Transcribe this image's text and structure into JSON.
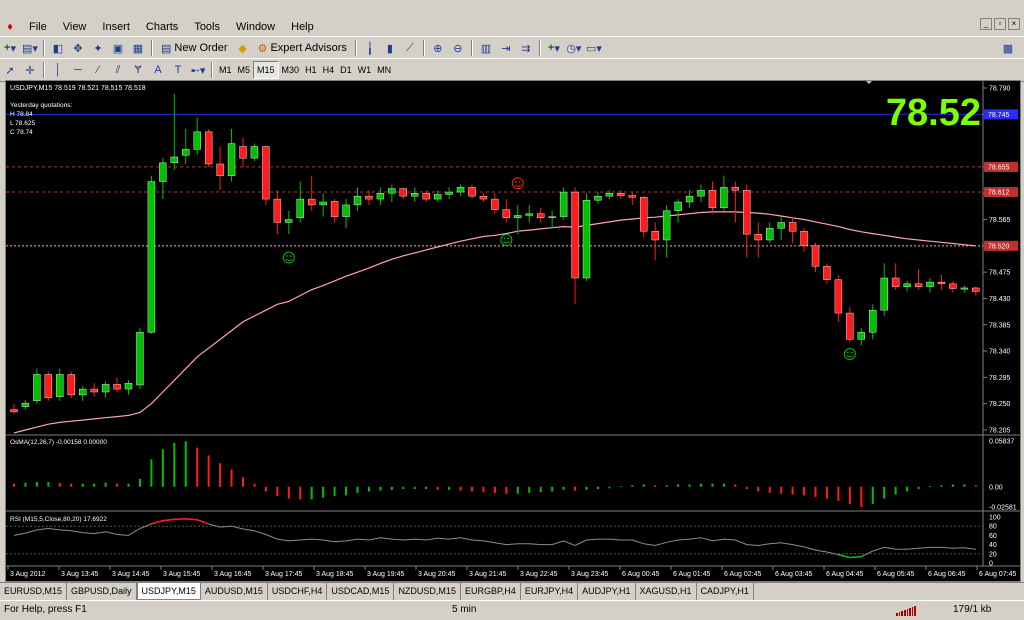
{
  "menu": [
    "File",
    "View",
    "Insert",
    "Charts",
    "Tools",
    "Window",
    "Help"
  ],
  "toolbar": {
    "new_order": "New Order",
    "expert_advisors": "Expert Advisors"
  },
  "timeframes": [
    "M1",
    "M5",
    "M15",
    "M30",
    "H1",
    "H4",
    "D1",
    "W1",
    "MN"
  ],
  "active_timeframe": "M15",
  "chart": {
    "header": "USDJPY,M15  78.519 78.521 78.515 78.518",
    "yesterday_title": "Yesterday quotations:",
    "y_high": "H 78.84",
    "y_low": "L 78.625",
    "y_close": "C 78.74",
    "big_price": "78.52",
    "price_ticks": [
      "78.790",
      "78.745",
      "78.655",
      "78.610",
      "78.565",
      "78.520",
      "78.475",
      "78.430",
      "78.385",
      "78.340",
      "78.295",
      "78.250",
      "78.205"
    ],
    "osma_label": "OsMA(12,26,7) -0.00158 0.00000",
    "osma_ticks": [
      "0.05837",
      "0.00",
      "-0.02581"
    ],
    "rsi_label": "RSI (M15,5,Close,80,20) 17.6922",
    "rsi_ticks": [
      "100",
      "80",
      "60",
      "40",
      "20",
      "0"
    ],
    "time_labels": [
      "3 Aug 2012",
      "3 Aug 13:45",
      "3 Aug 14:45",
      "3 Aug 15:45",
      "3 Aug 16:45",
      "3 Aug 17:45",
      "3 Aug 18:45",
      "3 Aug 19:45",
      "3 Aug 20:45",
      "3 Aug 21:45",
      "3 Aug 22:45",
      "3 Aug 23:45",
      "6 Aug 00:45",
      "6 Aug 01:45",
      "6 Aug 02:45",
      "6 Aug 03:45",
      "6 Aug 04:45",
      "6 Aug 05:45",
      "6 Aug 06:45",
      "6 Aug 07:45"
    ],
    "candles": [
      [
        78.24,
        78.25,
        78.232,
        78.236
      ],
      [
        78.245,
        78.256,
        78.24,
        78.251
      ],
      [
        78.255,
        78.31,
        78.25,
        78.3
      ],
      [
        78.3,
        78.305,
        78.255,
        78.26
      ],
      [
        78.262,
        78.31,
        78.255,
        78.3
      ],
      [
        78.3,
        78.305,
        78.26,
        78.265
      ],
      [
        78.265,
        78.28,
        78.255,
        78.275
      ],
      [
        78.275,
        78.285,
        78.262,
        78.27
      ],
      [
        78.27,
        78.288,
        78.26,
        78.283
      ],
      [
        78.283,
        78.295,
        78.27,
        78.275
      ],
      [
        78.275,
        78.29,
        78.265,
        78.285
      ],
      [
        78.282,
        78.38,
        78.275,
        78.372
      ],
      [
        78.372,
        78.64,
        78.37,
        78.63
      ],
      [
        78.63,
        78.67,
        78.6,
        78.662
      ],
      [
        78.662,
        78.78,
        78.65,
        78.672
      ],
      [
        78.675,
        78.72,
        78.66,
        78.685
      ],
      [
        78.685,
        78.74,
        78.675,
        78.715
      ],
      [
        78.715,
        78.72,
        78.655,
        78.66
      ],
      [
        78.66,
        78.69,
        78.615,
        78.64
      ],
      [
        78.64,
        78.72,
        78.63,
        78.695
      ],
      [
        78.69,
        78.705,
        78.655,
        78.67
      ],
      [
        78.67,
        78.695,
        78.665,
        78.69
      ],
      [
        78.69,
        78.69,
        78.59,
        78.6
      ],
      [
        78.6,
        78.615,
        78.54,
        78.56
      ],
      [
        78.56,
        78.58,
        78.54,
        78.565
      ],
      [
        78.568,
        78.63,
        78.56,
        78.6
      ],
      [
        78.6,
        78.64,
        78.58,
        78.59
      ],
      [
        78.59,
        78.61,
        78.57,
        78.595
      ],
      [
        78.596,
        78.6,
        78.56,
        78.57
      ],
      [
        78.57,
        78.6,
        78.55,
        78.59
      ],
      [
        78.59,
        78.62,
        78.58,
        78.605
      ],
      [
        78.605,
        78.615,
        78.59,
        78.6
      ],
      [
        78.6,
        78.62,
        78.59,
        78.61
      ],
      [
        78.61,
        78.625,
        78.595,
        78.618
      ],
      [
        78.618,
        78.62,
        78.6,
        78.605
      ],
      [
        78.605,
        78.62,
        78.595,
        78.61
      ],
      [
        78.61,
        78.615,
        78.595,
        78.6
      ],
      [
        78.6,
        78.615,
        78.595,
        78.608
      ],
      [
        78.608,
        78.62,
        78.6,
        78.612
      ],
      [
        78.612,
        78.625,
        78.605,
        78.62
      ],
      [
        78.62,
        78.625,
        78.6,
        78.605
      ],
      [
        78.605,
        78.61,
        78.595,
        78.6
      ],
      [
        78.6,
        78.61,
        78.575,
        78.582
      ],
      [
        78.582,
        78.6,
        78.56,
        78.568
      ],
      [
        78.568,
        78.59,
        78.54,
        78.572
      ],
      [
        78.572,
        78.59,
        78.56,
        78.575
      ],
      [
        78.575,
        78.585,
        78.56,
        78.568
      ],
      [
        78.568,
        78.58,
        78.55,
        78.57
      ],
      [
        78.57,
        78.62,
        78.565,
        78.612
      ],
      [
        78.612,
        78.62,
        78.42,
        78.465
      ],
      [
        78.465,
        78.61,
        78.46,
        78.598
      ],
      [
        78.598,
        78.612,
        78.592,
        78.605
      ],
      [
        78.605,
        78.615,
        78.6,
        78.61
      ],
      [
        78.61,
        78.615,
        78.6,
        78.606
      ],
      [
        78.606,
        78.612,
        78.59,
        78.603
      ],
      [
        78.603,
        78.605,
        78.535,
        78.545
      ],
      [
        78.545,
        78.56,
        78.495,
        78.53
      ],
      [
        78.53,
        78.59,
        78.5,
        78.58
      ],
      [
        78.58,
        78.6,
        78.56,
        78.595
      ],
      [
        78.595,
        78.615,
        78.585,
        78.605
      ],
      [
        78.605,
        78.625,
        78.595,
        78.615
      ],
      [
        78.615,
        78.63,
        78.575,
        78.585
      ],
      [
        78.585,
        78.64,
        78.58,
        78.62
      ],
      [
        78.62,
        78.63,
        78.56,
        78.615
      ],
      [
        78.615,
        78.625,
        78.5,
        78.54
      ],
      [
        78.54,
        78.56,
        78.5,
        78.53
      ],
      [
        78.53,
        78.56,
        78.525,
        78.55
      ],
      [
        78.55,
        78.57,
        78.53,
        78.56
      ],
      [
        78.56,
        78.57,
        78.525,
        78.545
      ],
      [
        78.545,
        78.55,
        78.51,
        78.52
      ],
      [
        78.52,
        78.525,
        78.475,
        78.485
      ],
      [
        78.485,
        78.49,
        78.455,
        78.462
      ],
      [
        78.462,
        78.47,
        78.39,
        78.405
      ],
      [
        78.405,
        78.415,
        78.355,
        78.36
      ],
      [
        78.36,
        78.38,
        78.35,
        78.372
      ],
      [
        78.372,
        78.42,
        78.36,
        78.41
      ],
      [
        78.41,
        78.49,
        78.4,
        78.465
      ],
      [
        78.465,
        78.49,
        78.445,
        78.45
      ],
      [
        78.45,
        78.46,
        78.442,
        78.455
      ],
      [
        78.455,
        78.48,
        78.445,
        78.45
      ],
      [
        78.45,
        78.465,
        78.44,
        78.458
      ],
      [
        78.458,
        78.47,
        78.445,
        78.455
      ],
      [
        78.455,
        78.46,
        78.44,
        78.447
      ],
      [
        78.447,
        78.452,
        78.44,
        78.448
      ],
      [
        78.448,
        78.45,
        78.435,
        78.442
      ]
    ],
    "osma": [
      0.004,
      0.005,
      0.006,
      0.006,
      0.005,
      0.004,
      0.004,
      0.004,
      0.005,
      0.004,
      0.004,
      0.01,
      0.035,
      0.048,
      0.056,
      0.058,
      0.05,
      0.04,
      0.03,
      0.022,
      0.012,
      0.004,
      -0.006,
      -0.012,
      -0.015,
      -0.016,
      -0.016,
      -0.014,
      -0.012,
      -0.011,
      -0.008,
      -0.006,
      -0.005,
      -0.004,
      -0.003,
      -0.003,
      -0.003,
      -0.004,
      -0.004,
      -0.005,
      -0.006,
      -0.007,
      -0.008,
      -0.009,
      -0.009,
      -0.008,
      -0.007,
      -0.006,
      -0.004,
      -0.005,
      -0.004,
      -0.003,
      -0.002,
      0.001,
      0.002,
      0.003,
      0.002,
      0.002,
      0.003,
      0.003,
      0.004,
      0.004,
      0.004,
      0.003,
      -0.003,
      -0.006,
      -0.008,
      -0.009,
      -0.01,
      -0.011,
      -0.013,
      -0.015,
      -0.018,
      -0.022,
      -0.026,
      -0.022,
      -0.015,
      -0.01,
      -0.006,
      -0.003,
      0.001,
      0.002,
      0.003,
      0.003,
      0.002
    ],
    "rsi": [
      60,
      65,
      72,
      75,
      72,
      70,
      66,
      64,
      68,
      62,
      60,
      75,
      85,
      92,
      95,
      96,
      94,
      85,
      78,
      80,
      74,
      70,
      62,
      52,
      48,
      50,
      52,
      50,
      46,
      48,
      52,
      50,
      55,
      52,
      50,
      52,
      50,
      54,
      52,
      55,
      50,
      48,
      44,
      40,
      42,
      42,
      40,
      40,
      48,
      38,
      50,
      52,
      52,
      50,
      50,
      42,
      38,
      45,
      50,
      52,
      55,
      48,
      52,
      50,
      40,
      38,
      42,
      44,
      40,
      35,
      28,
      24,
      18,
      12,
      14,
      26,
      34,
      30,
      30,
      32,
      34,
      34,
      32,
      33,
      30
    ],
    "ma": [
      78.2,
      78.205,
      78.21,
      78.215,
      78.218,
      78.22,
      78.222,
      78.224,
      78.226,
      78.228,
      78.23,
      78.235,
      78.25,
      78.27,
      78.29,
      78.31,
      78.33,
      78.345,
      78.36,
      78.375,
      78.39,
      78.4,
      78.41,
      78.42,
      78.425,
      78.435,
      78.445,
      78.452,
      78.46,
      78.468,
      78.475,
      78.482,
      78.49,
      78.497,
      78.503,
      78.508,
      78.513,
      78.518,
      78.523,
      78.528,
      78.532,
      78.536,
      78.538,
      78.541,
      78.545,
      78.547,
      78.549,
      78.551,
      78.553,
      78.552,
      78.555,
      78.558,
      78.561,
      78.564,
      78.566,
      78.568,
      78.569,
      78.571,
      78.573,
      78.575,
      78.577,
      78.578,
      78.578,
      78.578,
      78.577,
      78.576,
      78.574,
      78.571,
      78.568,
      78.565,
      78.561,
      78.557,
      78.553,
      78.548,
      78.544,
      78.541,
      78.538,
      78.535,
      78.532,
      78.53,
      78.528,
      78.526,
      78.524,
      78.522,
      78.52
    ]
  },
  "tabs": [
    "EURUSD,M15",
    "GBPUSD,Daily",
    "USDJPY,M15",
    "AUDUSD,M15",
    "USDCHF,H4",
    "USDCAD,M15",
    "NZDUSD,M15",
    "EURGBP,H4",
    "EURJPY,H4",
    "AUDJPY,H1",
    "XAGUSD,H1",
    "CADJPY,H1"
  ],
  "active_tab": "USDJPY,M15",
  "status": {
    "help": "For Help, press F1",
    "period": "5 min",
    "traffic": "179/1 kb"
  },
  "colors": {
    "bull": "#00c000",
    "bear": "#ff1c1c",
    "ma": "#ffa0c8",
    "hline_blue": "#2a2aff",
    "hline_red": "#c03030",
    "big_price": "#7cff00",
    "rsi": "#8c8c8c"
  }
}
